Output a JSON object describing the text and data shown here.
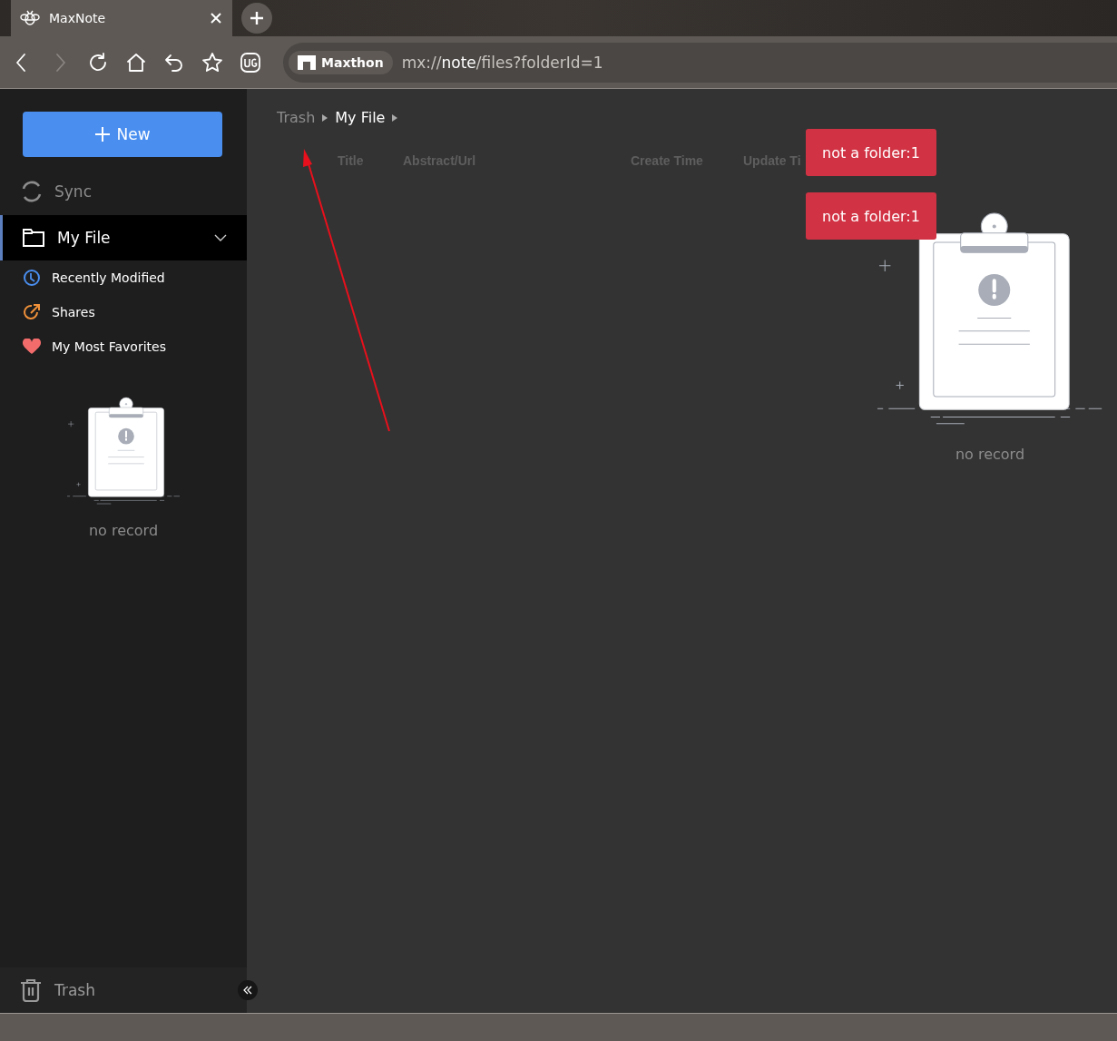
{
  "browser": {
    "tab": {
      "title": "MaxNote",
      "selected": true
    },
    "nav": {
      "back_enabled": true,
      "forward_enabled": false
    },
    "address": {
      "site_label": "Maxthon",
      "url_prefix": "mx://",
      "url_host": "note",
      "url_path": "/files?folderId=1"
    }
  },
  "sidebar": {
    "new_button": "New",
    "sync": "Sync",
    "items": [
      {
        "label": "My File",
        "kind": "folder",
        "selected": true,
        "expanded": true
      },
      {
        "label": "Recently Modified",
        "kind": "clock",
        "selected": false
      },
      {
        "label": "Shares",
        "kind": "share",
        "selected": false
      },
      {
        "label": "My Most Favorites",
        "kind": "heart",
        "selected": false
      }
    ],
    "empty_text": "no record",
    "trash": "Trash"
  },
  "breadcrumbs": [
    {
      "label": "Trash",
      "current": false
    },
    {
      "label": "My File",
      "current": true
    }
  ],
  "table": {
    "columns": [
      "Title",
      "Abstract/Url",
      "Create Time",
      "Update Ti"
    ]
  },
  "empty_text": "no record",
  "toasts": [
    "not a folder:1",
    "not a folder:1"
  ]
}
